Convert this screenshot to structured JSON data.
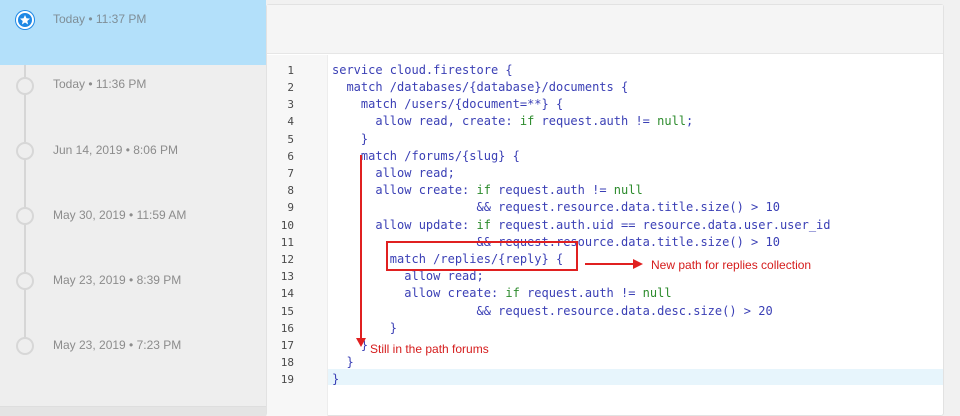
{
  "sidebar": {
    "versions": [
      {
        "label": "Today • 11:37 PM",
        "active": true
      },
      {
        "label": "Today • 11:36 PM",
        "active": false
      },
      {
        "label": "Jun 14, 2019 • 8:06 PM",
        "active": false
      },
      {
        "label": "May 30, 2019 • 11:59 AM",
        "active": false
      },
      {
        "label": "May 23, 2019 • 8:39 PM",
        "active": false
      },
      {
        "label": "May 23, 2019 • 7:23 PM",
        "active": false
      }
    ]
  },
  "editor": {
    "line_numbers": [
      "1",
      "2",
      "3",
      "4",
      "5",
      "6",
      "7",
      "8",
      "9",
      "10",
      "11",
      "12",
      "13",
      "14",
      "15",
      "16",
      "17",
      "18",
      "19"
    ],
    "code": {
      "l1": "service cloud.firestore {",
      "l2": "  match /databases/{database}/documents {",
      "l3": "    match /users/{document=**} {",
      "l4a": "      allow read, create: ",
      "l4b": "if",
      "l4c": " request.auth != ",
      "l4d": "null",
      "l4e": ";",
      "l5": "    }",
      "l6": "    match /forums/{slug} {",
      "l7": "      allow read;",
      "l8a": "      allow create: ",
      "l8b": "if",
      "l8c": " request.auth != ",
      "l8d": "null",
      "l9": "                    && request.resource.data.title.size() > 10",
      "l10a": "      allow update: ",
      "l10b": "if",
      "l10c": " request.auth.uid == resource.data.user.user_id",
      "l11": "                    && request.resource.data.title.size() > 10",
      "l12": "        match /replies/{reply} {",
      "l13": "          allow read;",
      "l14a": "          allow create: ",
      "l14b": "if",
      "l14c": " request.auth != ",
      "l14d": "null",
      "l15": "                    && request.resource.data.desc.size() > 20",
      "l16": "        }",
      "l17": "    }",
      "l18": "  }",
      "l19": "}"
    }
  },
  "annotations": {
    "replies": "New path for replies collection",
    "forums": "Still in the path forums"
  },
  "colors": {
    "accent": "#1e88e5",
    "selected_row": "#b3e0fa",
    "annotation": "#e02020"
  }
}
